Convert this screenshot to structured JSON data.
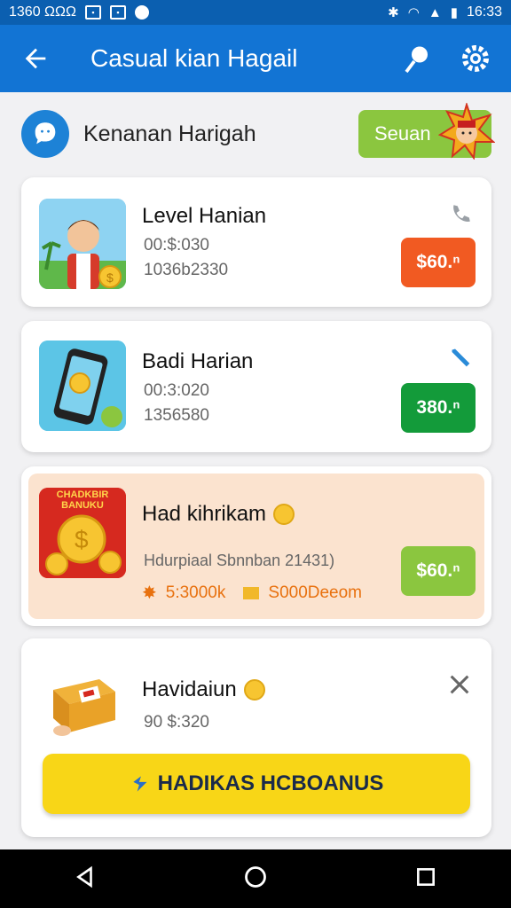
{
  "status_bar": {
    "time_left": "1360 ΩΩΩ",
    "time_right": "16:33"
  },
  "app_bar": {
    "title": "Casual kian Hagail",
    "back_icon": "arrow-left-icon",
    "pin_icon": "pin-icon",
    "settings_icon": "gear-icon"
  },
  "header": {
    "name": "Kenanan Harigah",
    "button_label": "Seuan"
  },
  "cards": [
    {
      "title": "Level Hanian",
      "line1": "00:$:030",
      "line2": "1036b2330",
      "price": "$60.ⁿ",
      "price_color": "#f15a22"
    },
    {
      "title": "Badi Harian",
      "line1": "00:3:020",
      "line2": "1356580",
      "price": "380.ⁿ",
      "price_color": "#139b3a"
    },
    {
      "title": "Had kihrikam",
      "line1": "Hdurpiaal Sbnnban 21431)",
      "reward1": "5:3000k",
      "reward2": "S000Deeom",
      "badge_text": "CHADKBIR BANUKU",
      "price": "$60.ⁿ",
      "price_color": "#8bc63f"
    },
    {
      "title": "Havidaiun",
      "line1": "90 $:320",
      "cta_label": "HADIKAS HCBOANUS"
    }
  ],
  "colors": {
    "app_bar": "#1274d4",
    "status_bar": "#0b5fb0",
    "cta": "#f8d617",
    "card3_bg": "#fbe3cf"
  }
}
